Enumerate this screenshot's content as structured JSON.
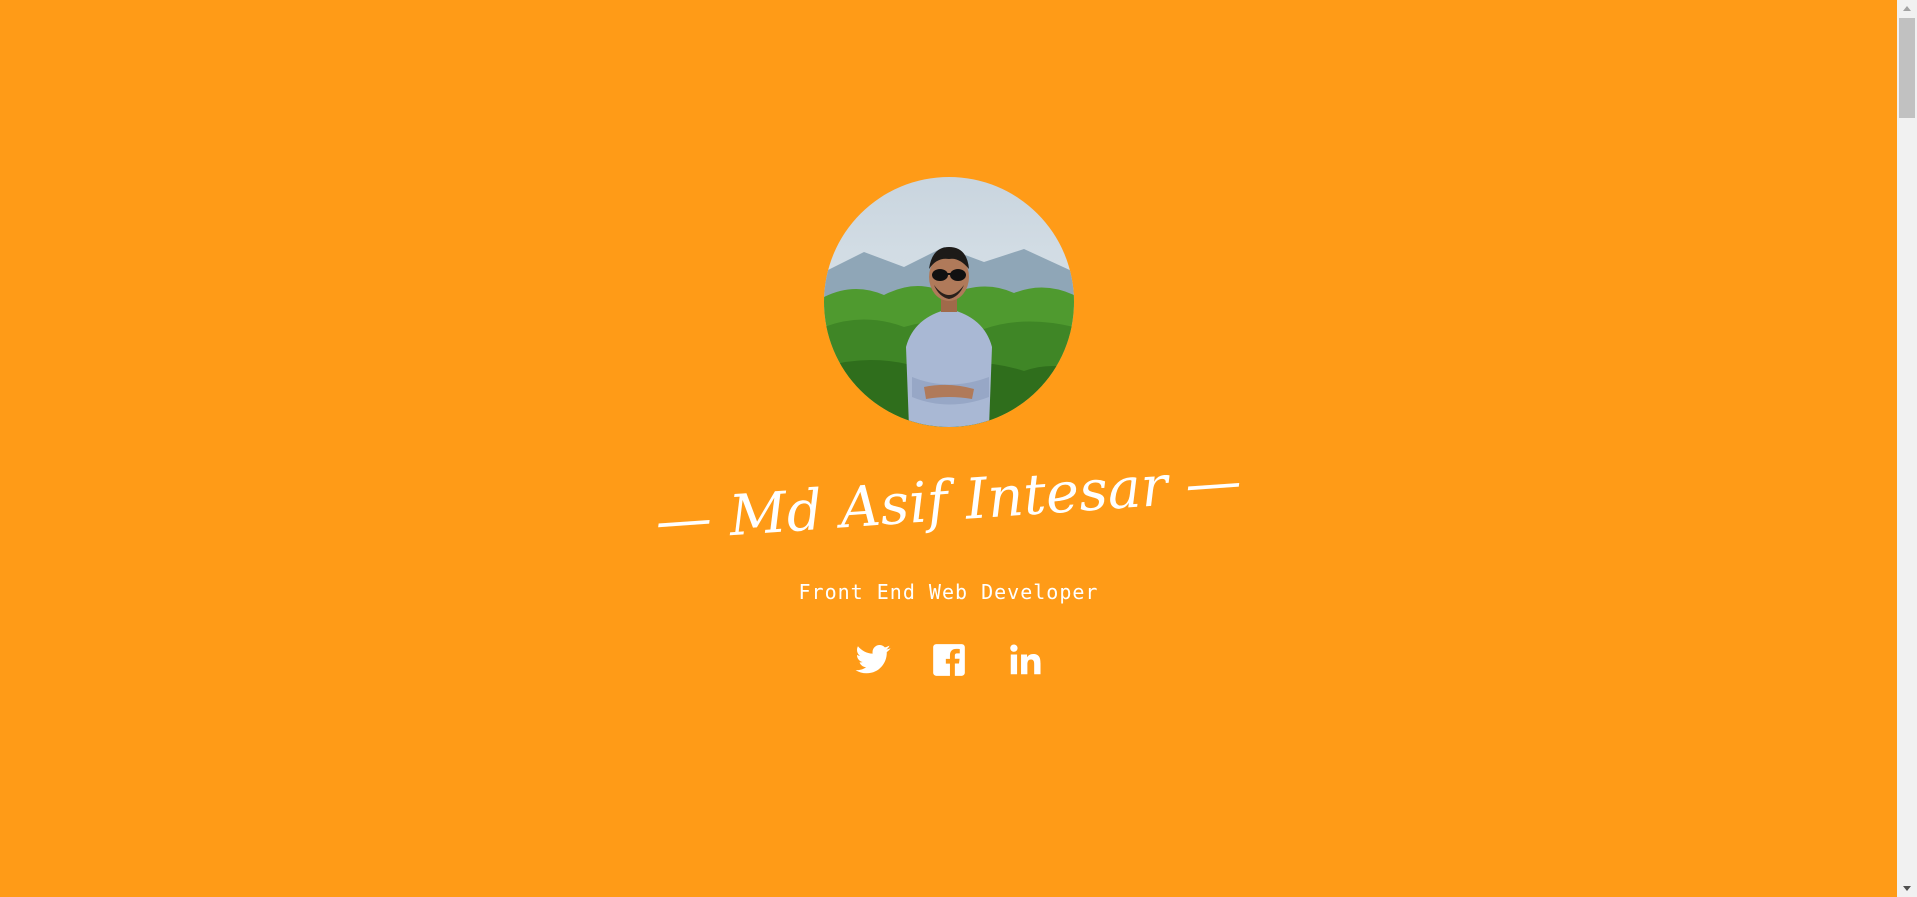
{
  "profile": {
    "name": "— Md Asif Intesar —",
    "role": "Front End Web Developer",
    "avatar_alt": "Profile photo"
  },
  "social": {
    "links": [
      {
        "name": "twitter",
        "icon": "twitter-icon"
      },
      {
        "name": "facebook",
        "icon": "facebook-icon"
      },
      {
        "name": "linkedin",
        "icon": "linkedin-icon"
      }
    ]
  },
  "theme": {
    "background": "#ff9b17",
    "text": "#ffffff"
  }
}
